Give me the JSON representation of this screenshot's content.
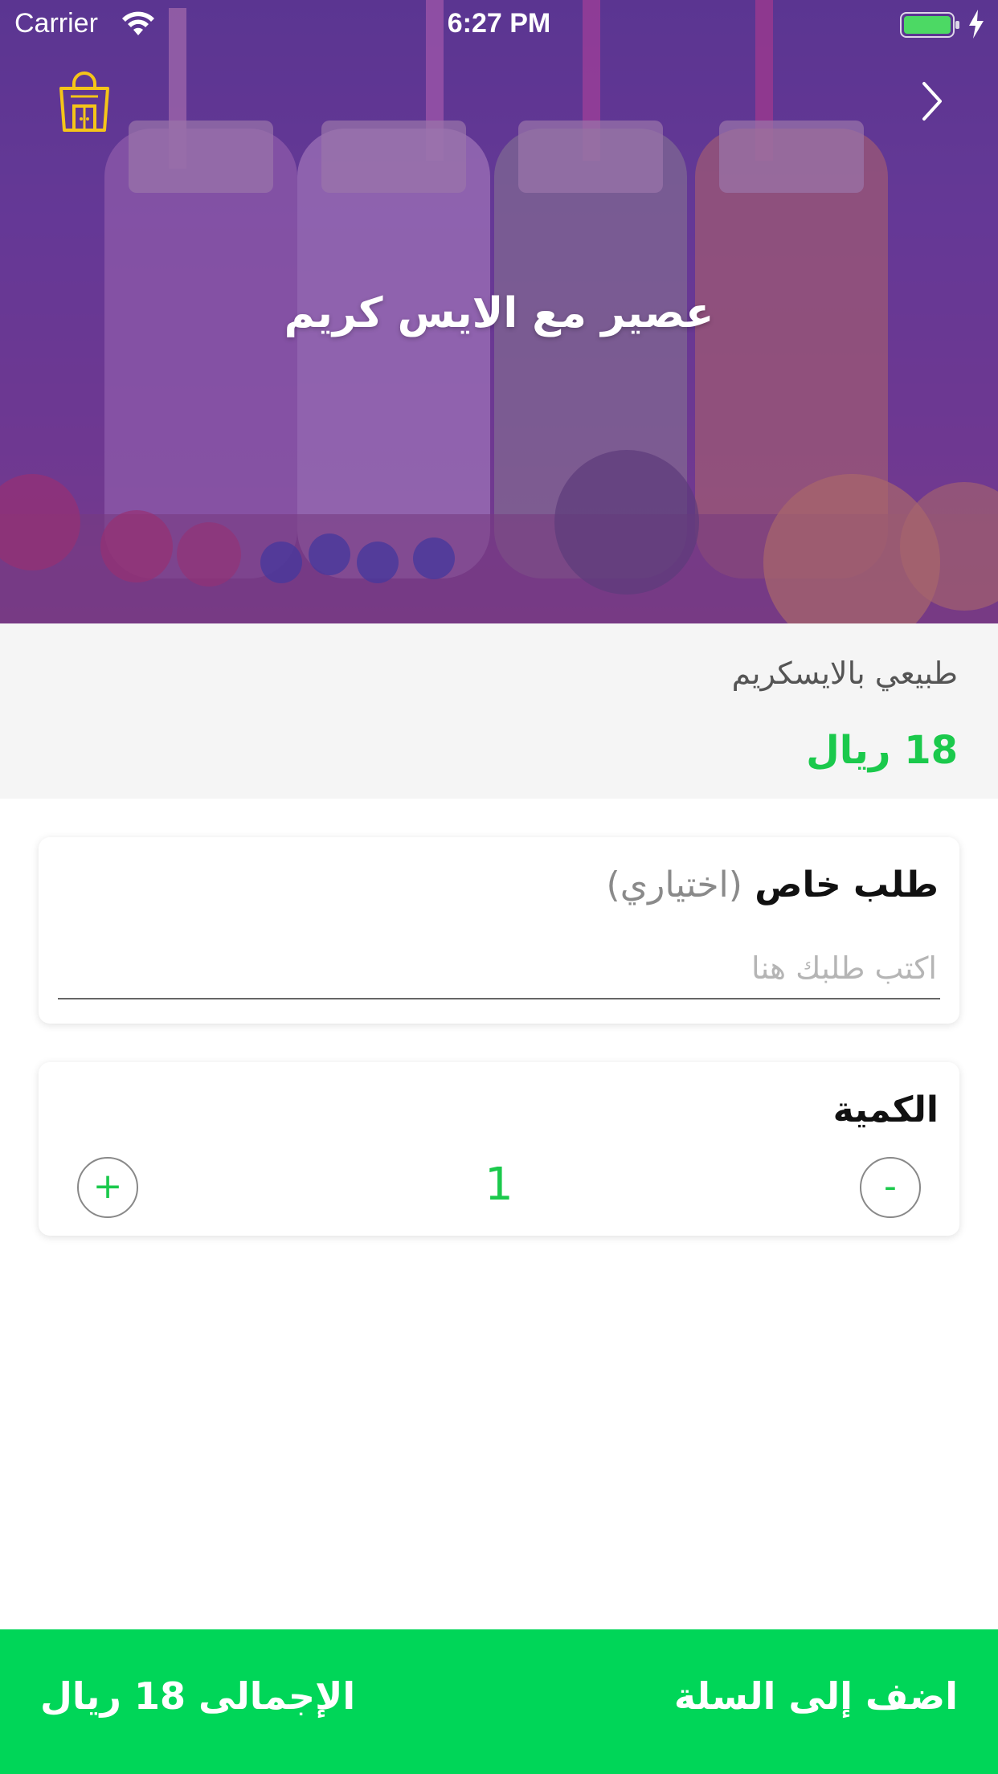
{
  "status_bar": {
    "carrier": "Carrier",
    "time": "6:27 PM"
  },
  "header": {
    "cart_icon": "shopping-bag-icon",
    "back_icon": "chevron-right-icon"
  },
  "product": {
    "title": "عصير مع الايس كريم",
    "description": "طبيعي بالايسكريم",
    "price": "18 ريال"
  },
  "special_request": {
    "title": "طلب خاص",
    "optional": "(اختياري)",
    "placeholder": "اكتب طلبك هنا",
    "value": ""
  },
  "quantity": {
    "title": "الكمية",
    "value": "1",
    "plus": "+",
    "minus": "-"
  },
  "footer": {
    "add_to_cart": "اضف إلى السلة",
    "total": "الإجمالى 18 ريال"
  },
  "colors": {
    "accent_green": "#00d658",
    "price_green": "#1bc94c",
    "cart_icon": "#f5c518"
  }
}
